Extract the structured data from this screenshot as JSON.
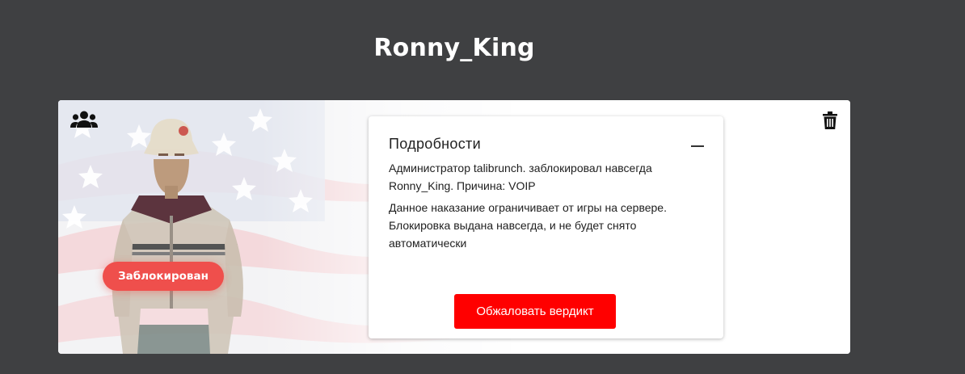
{
  "header": {
    "player_name": "Ronny_King"
  },
  "card": {
    "status_badge": "Заблокирован",
    "details": {
      "title": "Подробности",
      "summary": "Администратор talibrunch. заблокировал навсегда Ronny_King. Причина: VOIP",
      "explanation": "Данное наказание ограничивает от игры на сервере. Блокировка выдана навсегда, и не будет снято автоматически",
      "appeal_button": "Обжаловать вердикт"
    },
    "icons": {
      "group": "users-icon",
      "delete": "trash-icon",
      "collapse": "minus-icon"
    }
  },
  "colors": {
    "page_background": "#3f4042",
    "badge": "#ef4f4c",
    "appeal_button": "#ff0000"
  }
}
